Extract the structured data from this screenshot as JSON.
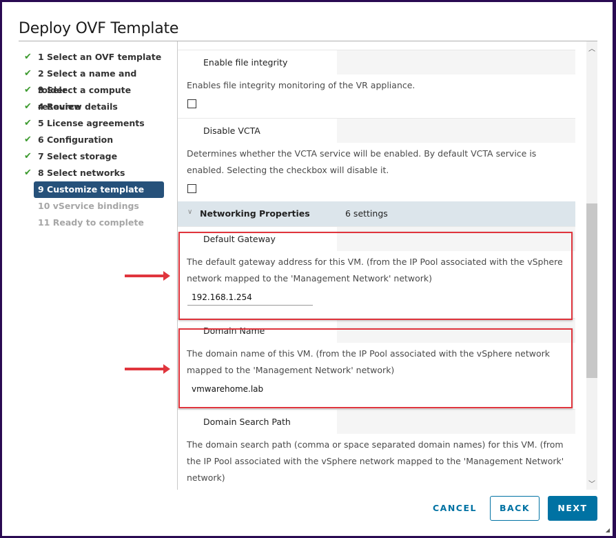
{
  "dialog": {
    "title": "Deploy OVF Template"
  },
  "steps": [
    {
      "label": "1 Select an OVF template",
      "state": "done"
    },
    {
      "label": "2 Select a name and folder",
      "state": "done"
    },
    {
      "label": "3 Select a compute resource",
      "state": "done"
    },
    {
      "label": "4 Review details",
      "state": "done"
    },
    {
      "label": "5 License agreements",
      "state": "done"
    },
    {
      "label": "6 Configuration",
      "state": "done"
    },
    {
      "label": "7 Select storage",
      "state": "done"
    },
    {
      "label": "8 Select networks",
      "state": "done"
    },
    {
      "label": "9 Customize template",
      "state": "active"
    },
    {
      "label": "10 vService bindings",
      "state": "pending"
    },
    {
      "label": "11 Ready to complete",
      "state": "pending"
    }
  ],
  "icons": {
    "check": "checkmark-icon",
    "chevron": "chevron-down-icon"
  },
  "properties": {
    "file_integrity": {
      "label": "Enable file integrity",
      "description": "Enables file integrity monitoring of the VR appliance.",
      "checked": false
    },
    "disable_vcta": {
      "label": "Disable VCTA",
      "description": "Determines whether the VCTA service will be enabled. By default VCTA service is enabled. Selecting the checkbox will disable it.",
      "checked": false
    },
    "networking": {
      "section_label": "Networking Properties",
      "count": "6 settings",
      "default_gateway": {
        "label": "Default Gateway",
        "description": "The default gateway address for this VM. (from the IP Pool associated with the vSphere network mapped to the 'Management Network' network)",
        "value": "192.168.1.254"
      },
      "domain_name": {
        "label": "Domain Name",
        "description": "The domain name of this VM. (from the IP Pool associated with the vSphere network mapped to the 'Management Network' network)",
        "value": "vmwarehome.lab"
      },
      "domain_search_path": {
        "label": "Domain Search Path",
        "description": "The domain search path (comma or space separated domain names) for this VM. (from the IP Pool associated with the vSphere network mapped to the 'Management Network' network)"
      }
    }
  },
  "footer": {
    "cancel": "CANCEL",
    "back": "BACK",
    "next": "NEXT"
  },
  "colors": {
    "accent": "#0072a3",
    "active_step": "#26517a",
    "highlight": "#e0353d",
    "check": "#3c9a2e"
  }
}
